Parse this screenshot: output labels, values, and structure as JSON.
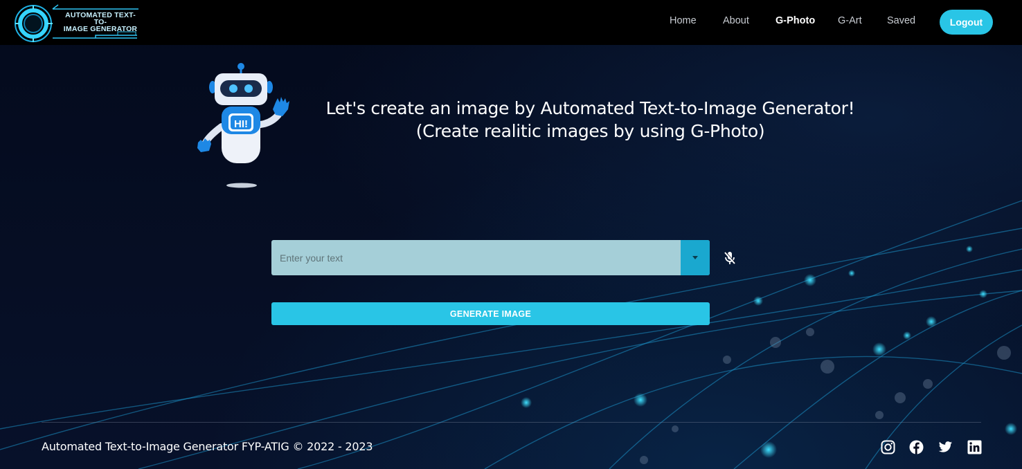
{
  "header": {
    "logo_text_line1": "AUTOMATED TEXT-TO-",
    "logo_text_line2": "IMAGE GENERATOR",
    "nav": {
      "home": "Home",
      "about": "About",
      "gphoto": "G-Photo",
      "gart": "G-Art",
      "saved": "Saved"
    },
    "active_nav": "G-Photo",
    "logout_label": "Logout"
  },
  "hero": {
    "robot_badge": "HI!",
    "line1": "Let's create an image by Automated Text-to-Image Generator!",
    "line2": "(Create realitic images by using G-Photo)"
  },
  "form": {
    "input_placeholder": "Enter your text",
    "input_value": "",
    "generate_label": "GENERATE IMAGE",
    "mic_icon": "mic-off-icon",
    "dropdown_icon": "caret-down-icon"
  },
  "footer": {
    "copyright": "Automated Text-to-Image Generator FYP-ATIG © 2022 - 2023",
    "social": [
      "instagram-icon",
      "facebook-icon",
      "twitter-icon",
      "linkedin-icon"
    ]
  },
  "colors": {
    "accent": "#29c5e6",
    "navbar": "#000000",
    "background": "#050b1e",
    "input": "#a5cfd8"
  }
}
